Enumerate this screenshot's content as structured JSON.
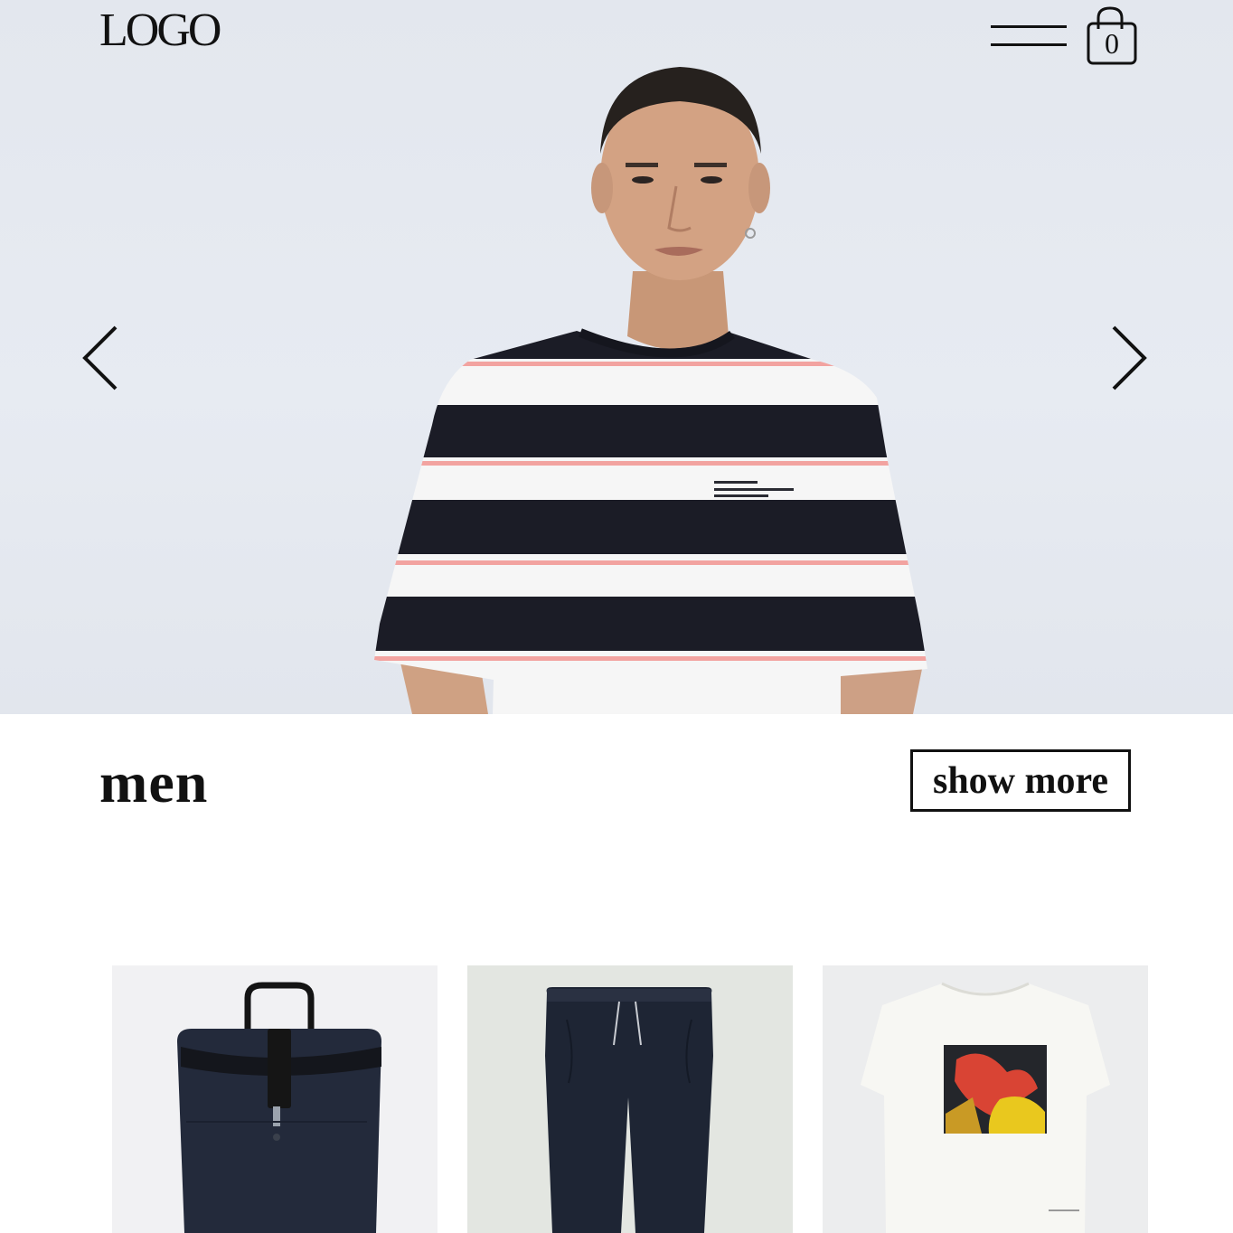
{
  "header": {
    "logo_text": "LOGO",
    "cart_count": "0",
    "icons": [
      "hamburger-menu-icon",
      "shopping-bag-icon"
    ]
  },
  "hero": {
    "icons": [
      "chevron-left-icon",
      "chevron-right-icon"
    ],
    "colors": {
      "background": "#e5e9f0",
      "stripe_dark": "#1b1c26",
      "stripe_accent": "#f2a3a0"
    }
  },
  "section": {
    "title": "men",
    "show_more_label": "show more"
  },
  "products": [
    {
      "image": "navy-rolltop-backpack"
    },
    {
      "image": "dark-navy-jogger-trousers"
    },
    {
      "image": "white-graphic-print-tshirt"
    }
  ]
}
